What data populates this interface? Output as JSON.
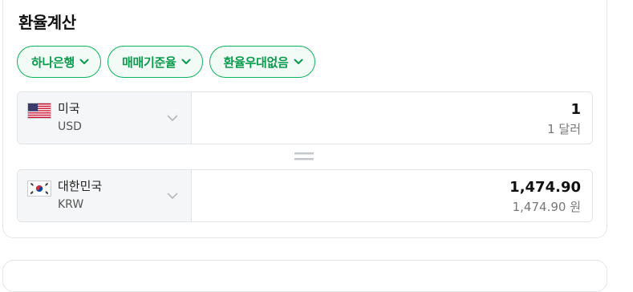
{
  "title": "환율계산",
  "chips": [
    {
      "label": "하나은행"
    },
    {
      "label": "매매기준율"
    },
    {
      "label": "환율우대없음"
    }
  ],
  "from": {
    "currency_name": "미국",
    "currency_code": "USD",
    "flag": "us-flag-icon",
    "amount_value": "1",
    "amount_text": "1 달러"
  },
  "to": {
    "currency_name": "대한민국",
    "currency_code": "KRW",
    "flag": "kr-flag-icon",
    "amount_value": "1,474.90",
    "amount_text": "1,474.90 원"
  },
  "colors": {
    "accent": "#0ab45a",
    "chip_bg": "#f2fbf6",
    "select_bg": "#f5f6f7",
    "border": "#e1e3e6"
  }
}
